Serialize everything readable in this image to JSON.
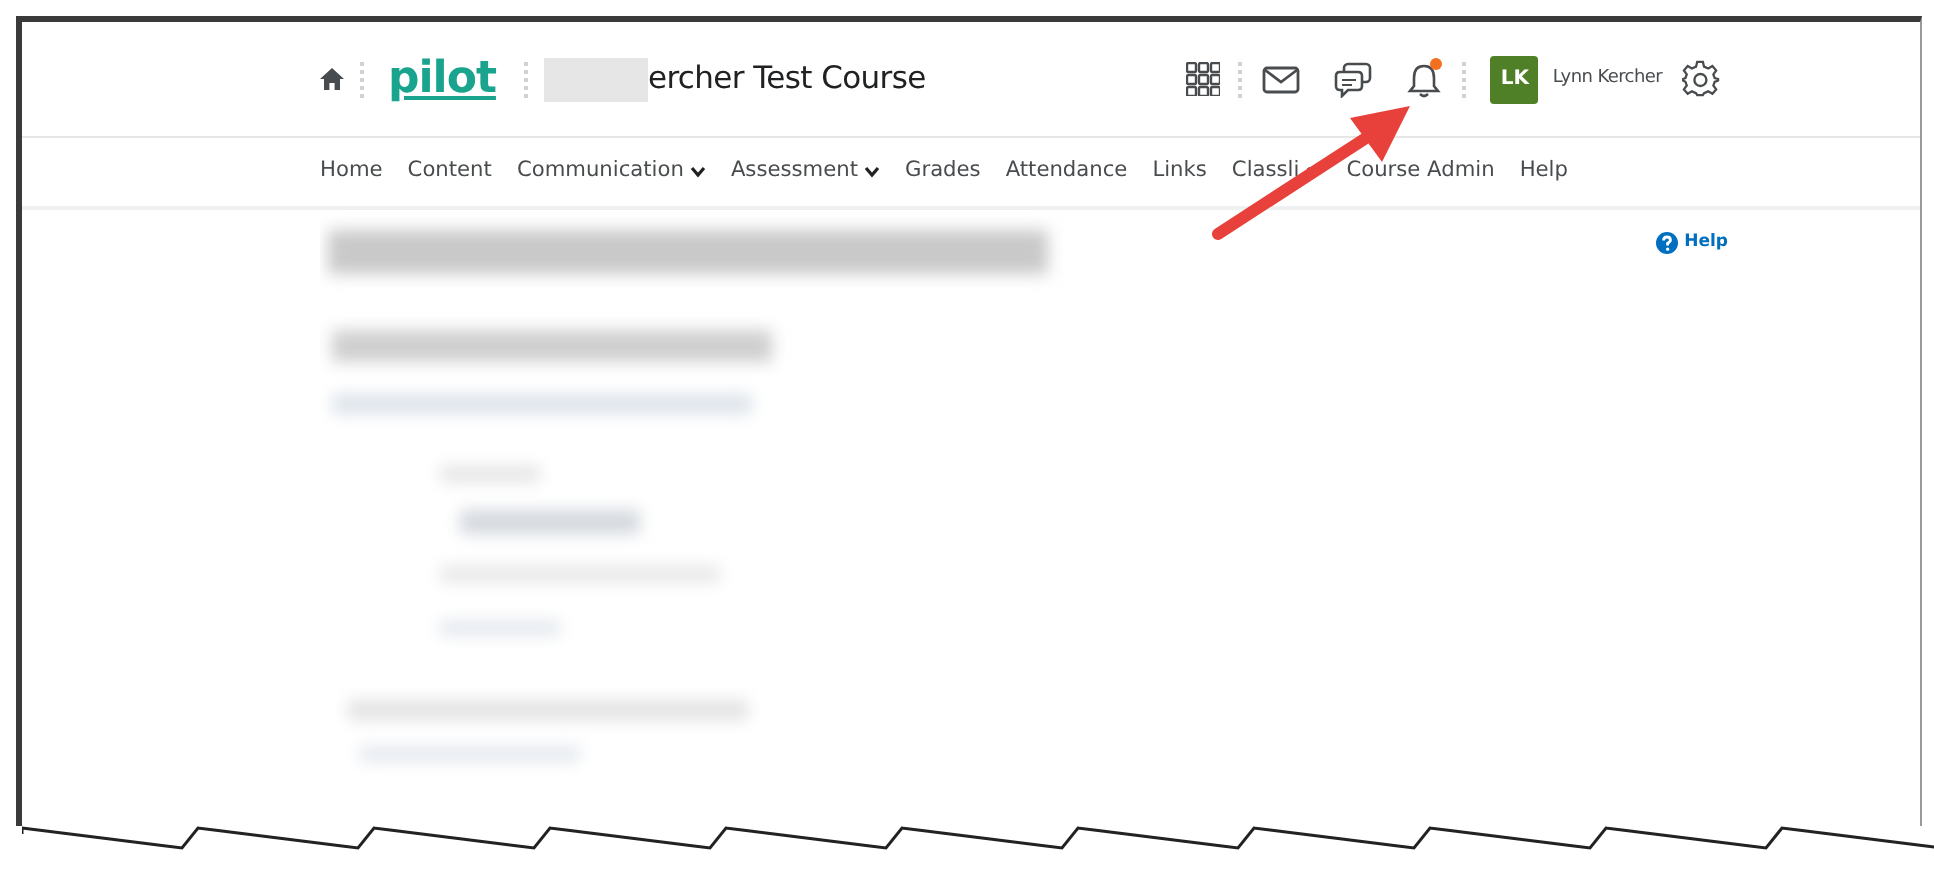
{
  "header": {
    "logo": "pilot",
    "course_title": "ercher Test Course",
    "course_prefix_redacted": true,
    "notifications_alert": true,
    "user": {
      "initials": "LK",
      "name": "Lynn Kercher",
      "color": "#4f7f26"
    }
  },
  "nav": [
    {
      "label": "Home",
      "dropdown": false
    },
    {
      "label": "Content",
      "dropdown": false
    },
    {
      "label": "Communication",
      "dropdown": true
    },
    {
      "label": "Assessment",
      "dropdown": true
    },
    {
      "label": "Grades",
      "dropdown": false
    },
    {
      "label": "Attendance",
      "dropdown": false
    },
    {
      "label": "Links",
      "dropdown": false
    },
    {
      "label": "Classli",
      "dropdown": true
    },
    {
      "label": "Course Admin",
      "dropdown": false
    },
    {
      "label": "Help",
      "dropdown": false
    }
  ],
  "page": {
    "help_link": "Help",
    "content": {
      "kind": "blurred"
    }
  },
  "annotation": {
    "kind": "arrow"
  }
}
